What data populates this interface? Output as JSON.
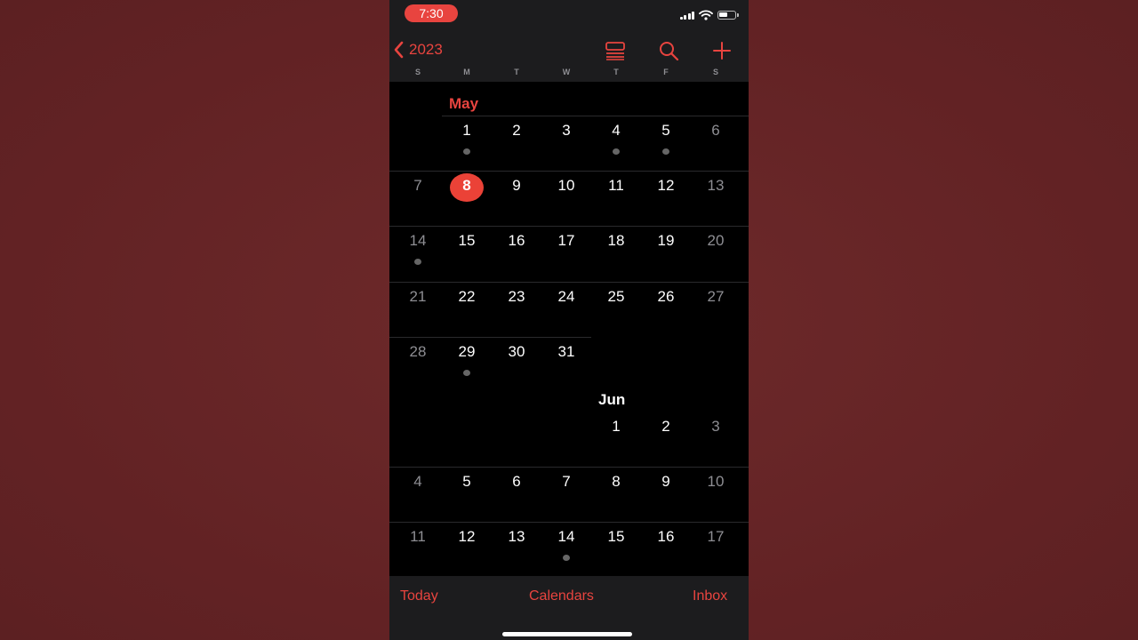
{
  "status_bar": {
    "time": "7:30"
  },
  "nav": {
    "back_label": "2023"
  },
  "weekdays": [
    "S",
    "M",
    "T",
    "W",
    "T",
    "F",
    "S"
  ],
  "months": [
    {
      "name": "May",
      "weeks": [
        [
          "",
          "1",
          "2",
          "3",
          "4",
          "5",
          "6"
        ],
        [
          "7",
          "8",
          "9",
          "10",
          "11",
          "12",
          "13"
        ],
        [
          "14",
          "15",
          "16",
          "17",
          "18",
          "19",
          "20"
        ],
        [
          "21",
          "22",
          "23",
          "24",
          "25",
          "26",
          "27"
        ],
        [
          "28",
          "29",
          "30",
          "31",
          "",
          "",
          ""
        ]
      ]
    },
    {
      "name": "Jun",
      "weeks": [
        [
          "",
          "",
          "",
          "",
          "1",
          "2",
          "3"
        ],
        [
          "4",
          "5",
          "6",
          "7",
          "8",
          "9",
          "10"
        ],
        [
          "11",
          "12",
          "13",
          "14",
          "15",
          "16",
          "17"
        ]
      ]
    }
  ],
  "today": "May 8",
  "event_days": [
    "May 1",
    "May 4",
    "May 5",
    "May 14",
    "May 29",
    "Jun 14"
  ],
  "tabs": {
    "today": "Today",
    "calendars": "Calendars",
    "inbox": "Inbox"
  },
  "colors": {
    "accent": "#e8443f",
    "today_circle": "#eb4237",
    "background": "#000000",
    "bars": "#1c1c1e"
  }
}
